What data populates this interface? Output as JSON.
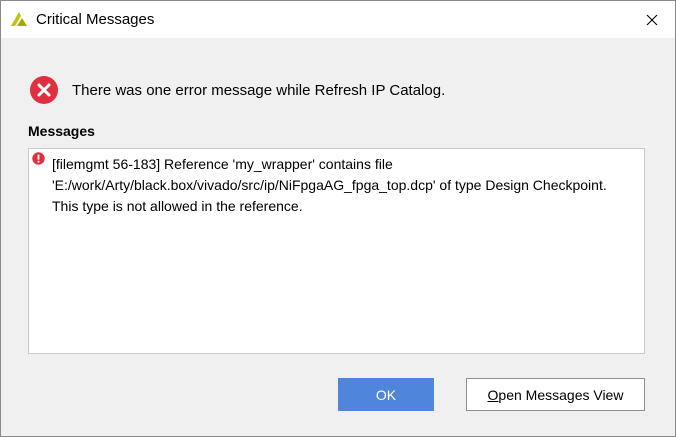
{
  "window": {
    "title": "Critical Messages",
    "logo_icon": "vivado-logo-icon",
    "close_icon": "close-icon"
  },
  "header": {
    "icon": "error-icon",
    "text": "There was one error message while Refresh IP Catalog."
  },
  "messages": {
    "label": "Messages",
    "items": [
      {
        "icon": "error-icon",
        "text": "[filemgmt 56-183] Reference 'my_wrapper' contains file 'E:/work/Arty/black.box/vivado/src/ip/NiFpgaAG_fpga_top.dcp' of type Design Checkpoint. This type is not allowed in the reference."
      }
    ]
  },
  "buttons": {
    "ok_label": "OK",
    "open_messages_view_mnemonic": "O",
    "open_messages_view_rest": "pen Messages View"
  },
  "colors": {
    "accent": "#4f86dc",
    "error": "#e0303f",
    "logo": "#c2c20e"
  }
}
